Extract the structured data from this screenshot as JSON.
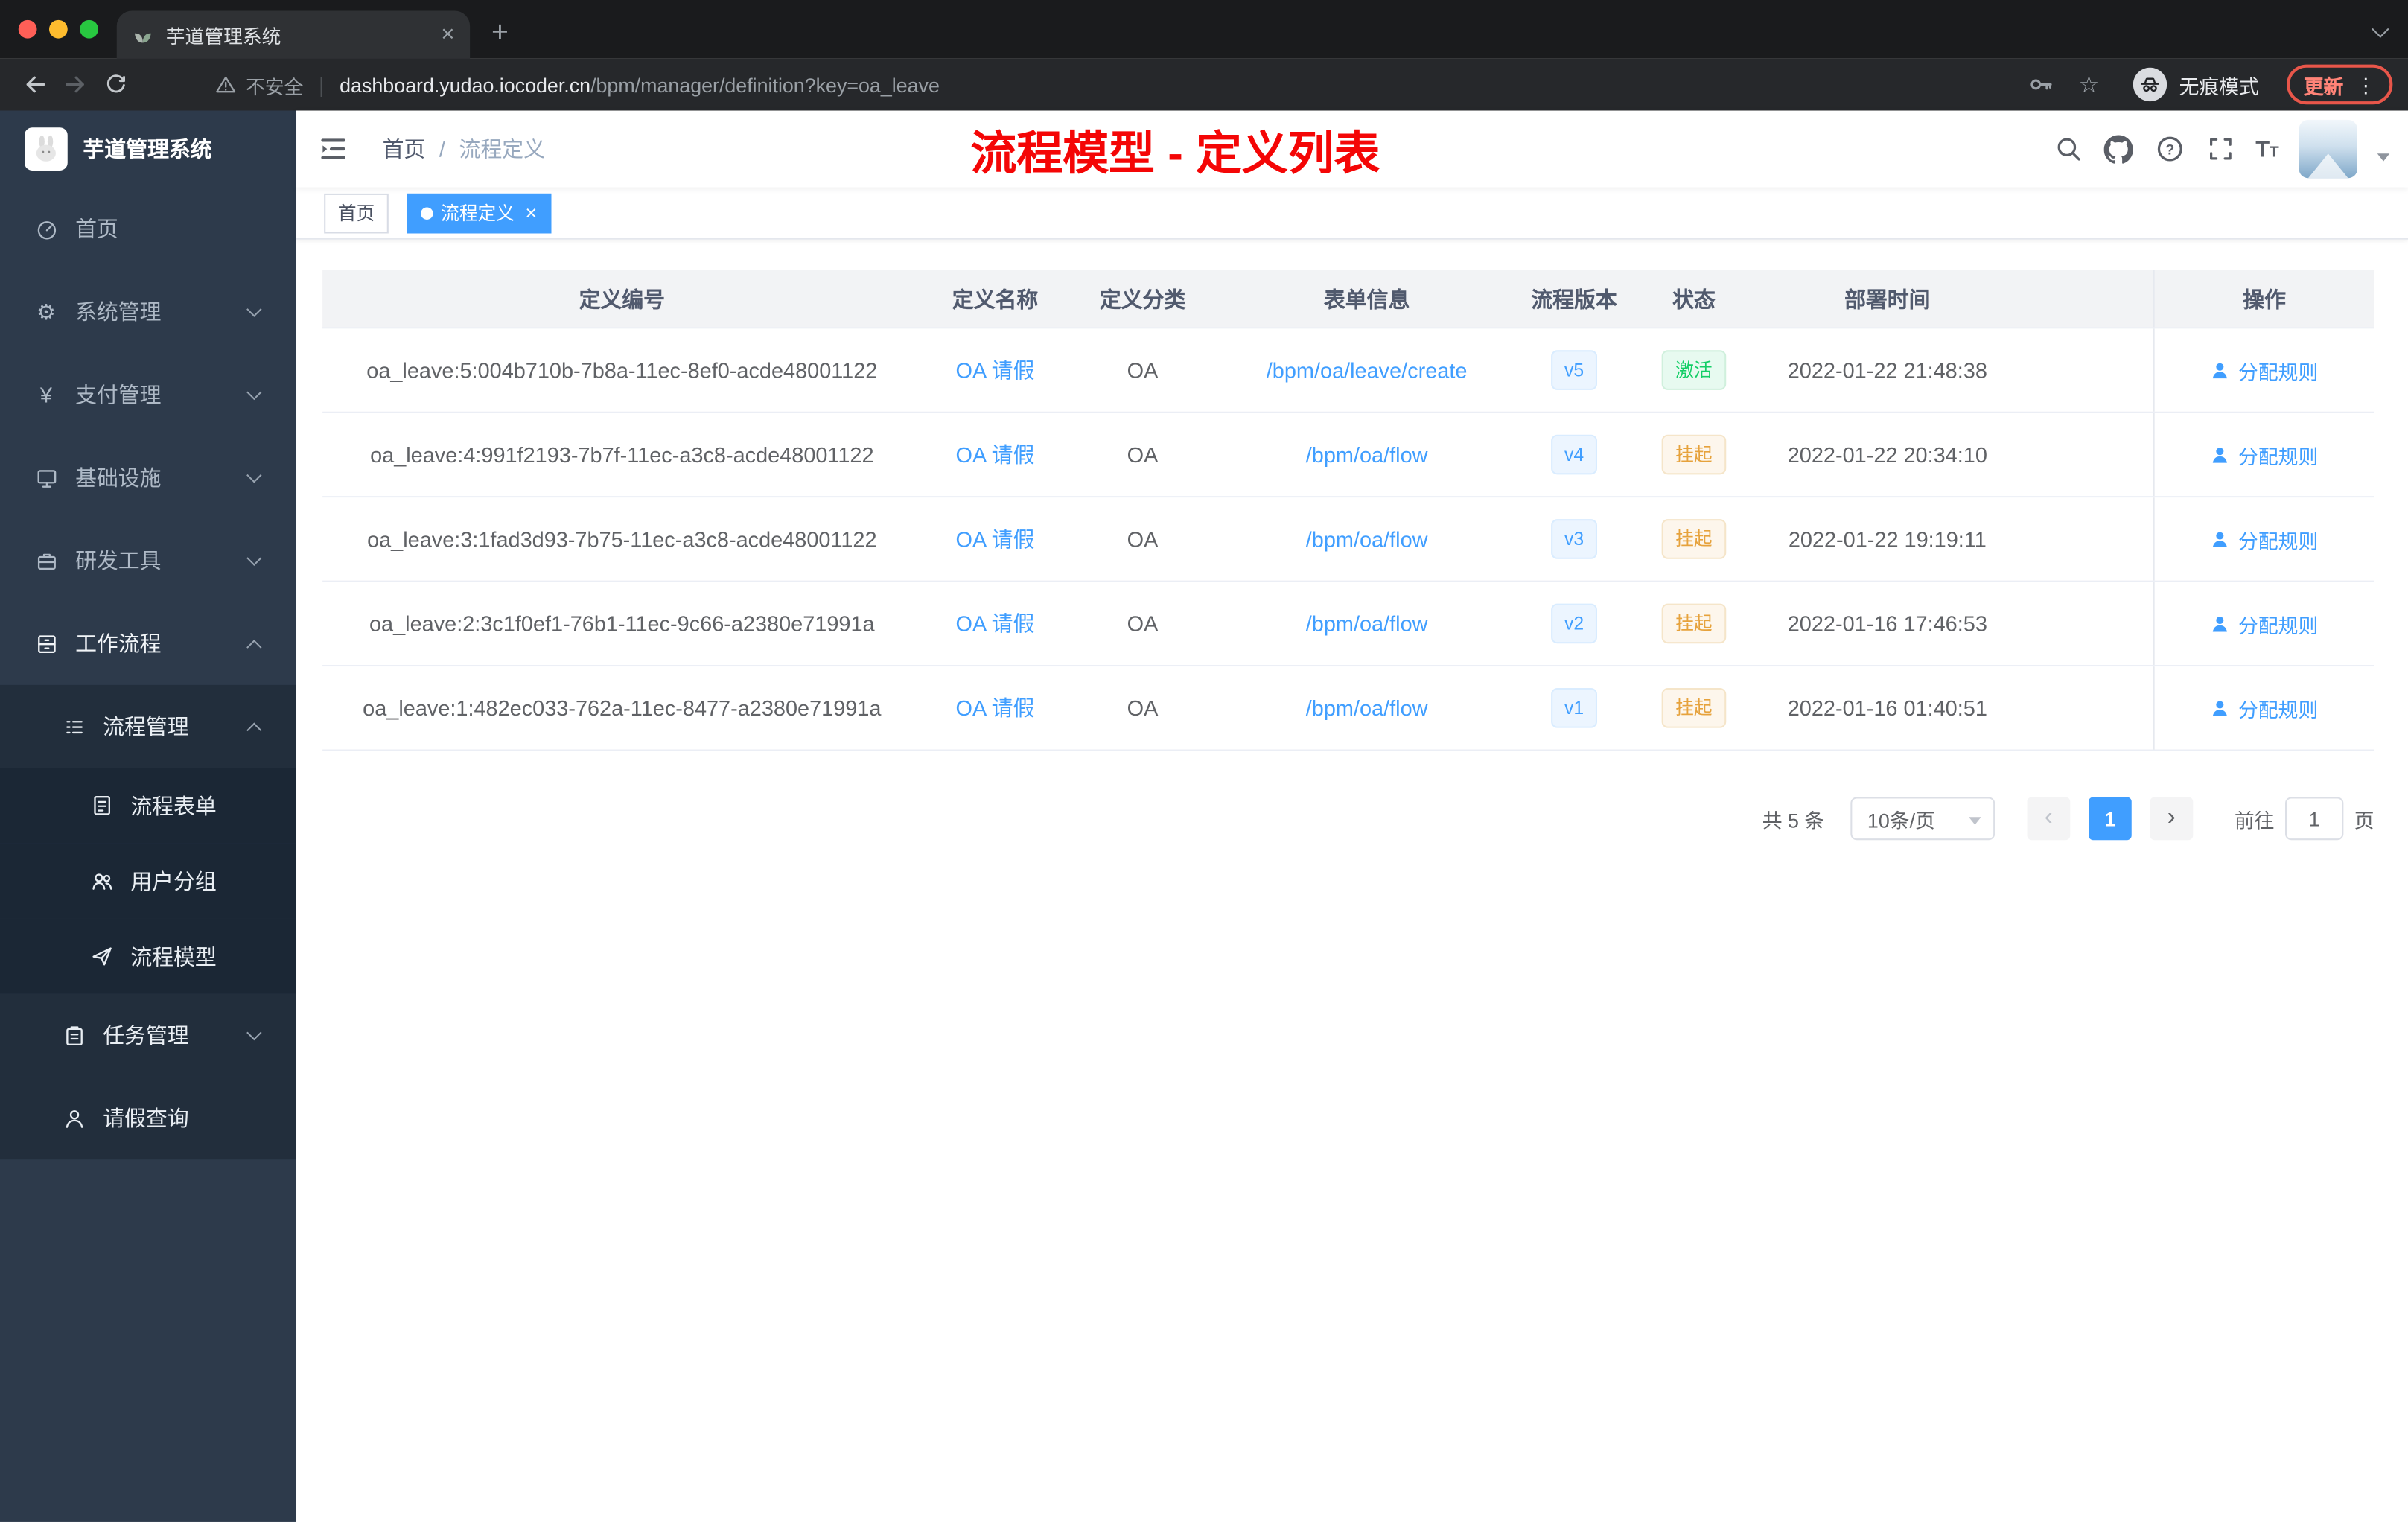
{
  "colors": {
    "primary": "#409eff",
    "success": "#13ce66",
    "warning": "#e6a23c",
    "annotation_red": "#f40606",
    "sidebar_bg": "#2d3a4b",
    "tag_active_bg": "#409eff"
  },
  "browser": {
    "tab_title": "芋道管理系统",
    "security_label": "不安全",
    "url_host": "dashboard.yudao.iocoder.cn",
    "url_path": "/bpm/manager/definition?key=oa_leave",
    "incognito_label": "无痕模式",
    "update_label": "更新",
    "icons": [
      "back-icon",
      "forward-icon",
      "reload-icon",
      "warning-icon",
      "key-icon",
      "star-icon",
      "incognito-icon",
      "kebab-menu-icon",
      "tab-favicon",
      "close-icon",
      "new-tab-icon",
      "chevron-down-icon"
    ]
  },
  "sidebar": {
    "brand": "芋道管理系统",
    "items": [
      {
        "key": "home",
        "label": "首页",
        "level": 1,
        "icon": "dashboard-icon",
        "chevron": null,
        "active": false
      },
      {
        "key": "system-mgmt",
        "label": "系统管理",
        "level": 1,
        "icon": "gear-icon",
        "chevron": "down",
        "active": false
      },
      {
        "key": "payment-mgmt",
        "label": "支付管理",
        "level": 1,
        "icon": "yen-icon",
        "chevron": "down",
        "active": false
      },
      {
        "key": "infrastructure",
        "label": "基础设施",
        "level": 1,
        "icon": "monitor-icon",
        "chevron": "down",
        "active": false
      },
      {
        "key": "dev-tools",
        "label": "研发工具",
        "level": 1,
        "icon": "toolbox-icon",
        "chevron": "down",
        "active": false
      },
      {
        "key": "workflow",
        "label": "工作流程",
        "level": 1,
        "icon": "cabinet-icon",
        "chevron": "up",
        "active": true
      },
      {
        "key": "process-mgmt",
        "label": "流程管理",
        "level": 2,
        "icon": "list-icon",
        "chevron": "up",
        "active": false
      },
      {
        "key": "process-form",
        "label": "流程表单",
        "level": 3,
        "icon": "document-icon",
        "chevron": null,
        "active": false
      },
      {
        "key": "user-group",
        "label": "用户分组",
        "level": 3,
        "icon": "user-group-icon",
        "chevron": null,
        "active": false
      },
      {
        "key": "process-model",
        "label": "流程模型",
        "level": 3,
        "icon": "send-icon",
        "chevron": null,
        "active": false
      },
      {
        "key": "task-mgmt",
        "label": "任务管理",
        "level": 2,
        "icon": "clipboard-icon",
        "chevron": "down",
        "active": false
      },
      {
        "key": "leave-query",
        "label": "请假查询",
        "level": 2,
        "icon": "person-icon",
        "chevron": null,
        "active": false
      }
    ]
  },
  "header": {
    "breadcrumb": [
      "首页",
      "流程定义"
    ],
    "annotation": "流程模型 - 定义列表",
    "icons": [
      "search-icon",
      "github-icon",
      "help-icon",
      "fullscreen-icon",
      "font-size-icon",
      "avatar",
      "chevron-down-icon"
    ]
  },
  "tags": [
    {
      "label": "首页",
      "active": false,
      "closable": false
    },
    {
      "label": "流程定义",
      "active": true,
      "closable": true
    }
  ],
  "table": {
    "columns": [
      "定义编号",
      "定义名称",
      "定义分类",
      "表单信息",
      "流程版本",
      "状态",
      "部署时间",
      "操作"
    ],
    "action_label": "分配规则",
    "action_icon": "user-icon",
    "rows": [
      {
        "id": "oa_leave:5:004b710b-7b8a-11ec-8ef0-acde48001122",
        "name": "OA 请假",
        "category": "OA",
        "form": "/bpm/oa/leave/create",
        "version": "v5",
        "status": "激活",
        "status_type": "success",
        "time": "2022-01-22 21:48:38"
      },
      {
        "id": "oa_leave:4:991f2193-7b7f-11ec-a3c8-acde48001122",
        "name": "OA 请假",
        "category": "OA",
        "form": "/bpm/oa/flow",
        "version": "v4",
        "status": "挂起",
        "status_type": "warning",
        "time": "2022-01-22 20:34:10"
      },
      {
        "id": "oa_leave:3:1fad3d93-7b75-11ec-a3c8-acde48001122",
        "name": "OA 请假",
        "category": "OA",
        "form": "/bpm/oa/flow",
        "version": "v3",
        "status": "挂起",
        "status_type": "warning",
        "time": "2022-01-22 19:19:11"
      },
      {
        "id": "oa_leave:2:3c1f0ef1-76b1-11ec-9c66-a2380e71991a",
        "name": "OA 请假",
        "category": "OA",
        "form": "/bpm/oa/flow",
        "version": "v2",
        "status": "挂起",
        "status_type": "warning",
        "time": "2022-01-16 17:46:53"
      },
      {
        "id": "oa_leave:1:482ec033-762a-11ec-8477-a2380e71991a",
        "name": "OA 请假",
        "category": "OA",
        "form": "/bpm/oa/flow",
        "version": "v1",
        "status": "挂起",
        "status_type": "warning",
        "time": "2022-01-16 01:40:51"
      }
    ]
  },
  "pagination": {
    "total": "共 5 条",
    "page_size": "10条/页",
    "prev": "‹",
    "current_page": "1",
    "next": "›",
    "goto": "前往",
    "goto_value": "1",
    "unit": "页"
  }
}
